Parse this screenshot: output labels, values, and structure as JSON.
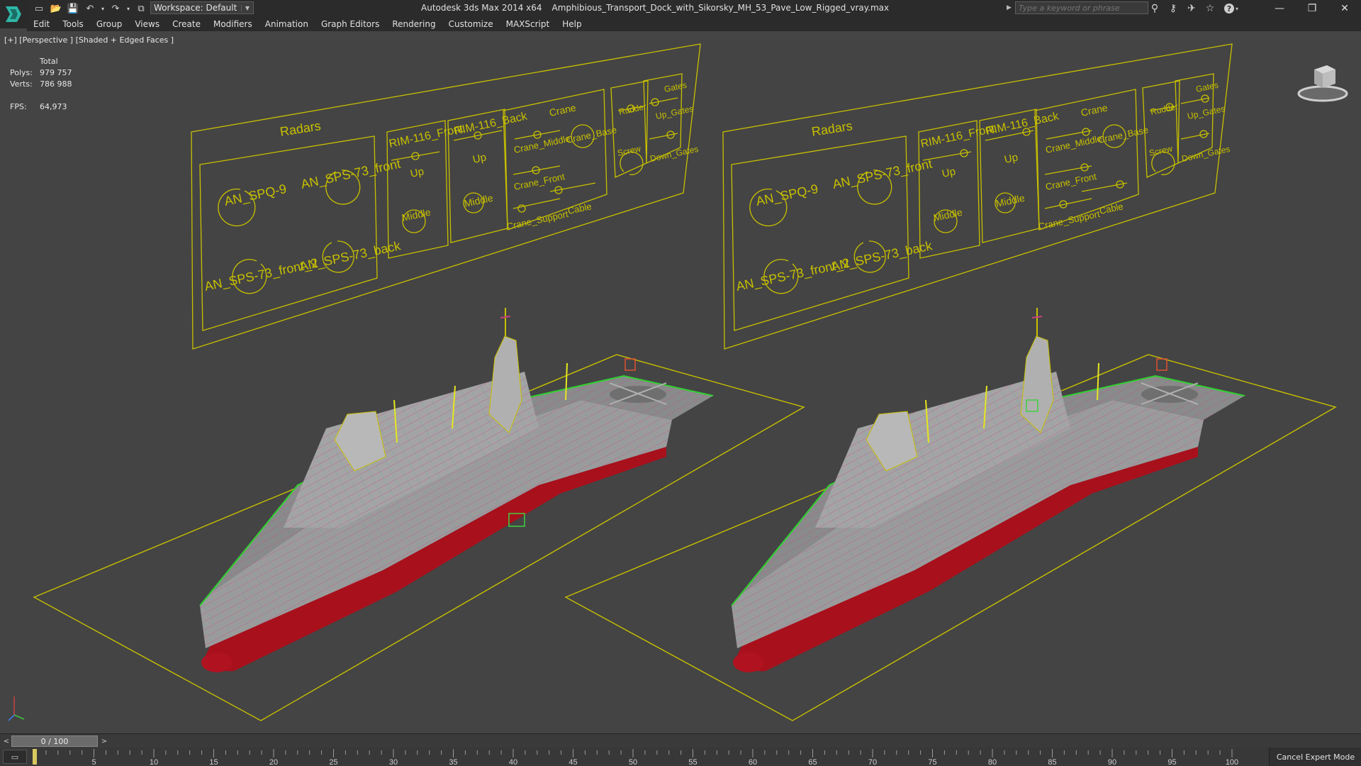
{
  "window": {
    "app_name": "Autodesk 3ds Max  2014 x64",
    "file_name": "Amphibious_Transport_Dock_with_Sikorsky_MH_53_Pave_Low_Rigged_vray.max",
    "workspace_label": "Workspace: Default",
    "search_placeholder": "Type a keyword or phrase",
    "accent_color": "#2fb7a8",
    "window_buttons": [
      "—",
      "❐",
      "✕"
    ]
  },
  "menu": [
    {
      "label": "Edit"
    },
    {
      "label": "Tools"
    },
    {
      "label": "Group"
    },
    {
      "label": "Views"
    },
    {
      "label": "Create"
    },
    {
      "label": "Modifiers"
    },
    {
      "label": "Animation"
    },
    {
      "label": "Graph Editors"
    },
    {
      "label": "Rendering"
    },
    {
      "label": "Customize"
    },
    {
      "label": "MAXScript"
    },
    {
      "label": "Help"
    }
  ],
  "viewport": {
    "label": "[+] [Perspective ] [Shaded + Edged Faces ]",
    "stats": {
      "header": "Total",
      "polys_label": "Polys:",
      "polys": "979 757",
      "verts_label": "Verts:",
      "verts": "786 988",
      "fps_label": "FPS:",
      "fps": "64,973"
    },
    "wire_color": "#c8c000",
    "panels": [
      {
        "radars_title": "Radars",
        "radars": [
          "AN_SPQ-9",
          "AN_SPS-73_front",
          "AN_SPS-73_front_2",
          "AN_SPS-73_back"
        ],
        "rim_front_title": "RIM-116_Front",
        "rim_back_title": "RIM-116_Back",
        "up": "Up",
        "middle": "Middle",
        "crane_title": "Crane",
        "crane_items": [
          "Crane_Middle",
          "Crane_Base",
          "Crane_Front",
          "Crane_Support",
          "Cable"
        ],
        "rudder_title": "Rudder",
        "screw": "Screw",
        "gates_title": "Gates",
        "gates": [
          "Up_Gates",
          "Down_Gates"
        ]
      },
      {
        "radars_title": "Radars",
        "radars": [
          "AN_SPQ-9",
          "AN_SPS-73_front",
          "AN_SPS-73_front_2",
          "AN_SPS-73_back"
        ],
        "rim_front_title": "RIM-116_Front",
        "rim_back_title": "RIM-116_Back",
        "up": "Up",
        "middle": "Middle",
        "crane_title": "Crane",
        "crane_items": [
          "Crane_Middle",
          "Crane_Base",
          "Crane_Front",
          "Crane_Support",
          "Cable"
        ],
        "rudder_title": "Rudder",
        "screw": "Screw",
        "gates_title": "Gates",
        "gates": [
          "Up_Gates",
          "Down_Gates"
        ]
      }
    ]
  },
  "timeline": {
    "frame_display": "0 / 100",
    "ticks": [
      "5",
      "10",
      "15",
      "20",
      "25",
      "30",
      "35",
      "40",
      "45",
      "50",
      "55",
      "60",
      "65",
      "70",
      "75",
      "80",
      "85",
      "90",
      "95",
      "100"
    ],
    "cancel_expert_label": "Cancel Expert Mode"
  }
}
